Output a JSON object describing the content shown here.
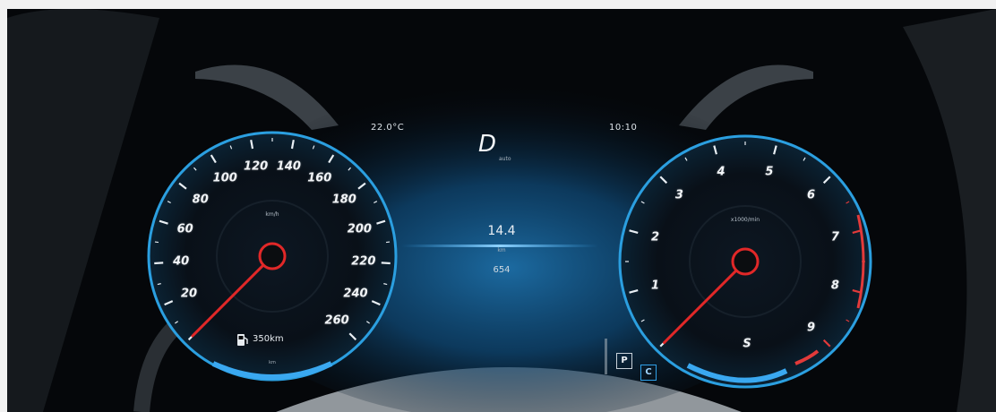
{
  "colors": {
    "background": "#05070a",
    "dial_ring": "#2b9fe0",
    "needle": "#e12828",
    "redline": "#e23a3a",
    "glow": "#3aa8f0"
  },
  "header": {
    "outside_temp": "22.0°C",
    "clock": "10:10"
  },
  "speedometer": {
    "labels": [
      "20",
      "40",
      "60",
      "80",
      "100",
      "120",
      "140",
      "160",
      "180",
      "200",
      "220",
      "240",
      "260"
    ],
    "min": 0,
    "max": 260,
    "value": 0,
    "unit": "km/h",
    "range_text": "350km",
    "icon": "fuel-pump-icon",
    "bottom_text": "km"
  },
  "center": {
    "gear": "D",
    "gear_sub": "auto",
    "upper_value": "14.4",
    "unit": "km",
    "lower_value": "654"
  },
  "tachometer": {
    "labels": [
      "1",
      "2",
      "3",
      "4",
      "5",
      "6",
      "7",
      "8",
      "9"
    ],
    "min": 0,
    "max": 9,
    "value": 0.0,
    "unit": "x1000/min",
    "bottom_label": "S",
    "redline_from": 6.5
  },
  "indicators": {
    "box_1": "P",
    "box_2": "C"
  }
}
